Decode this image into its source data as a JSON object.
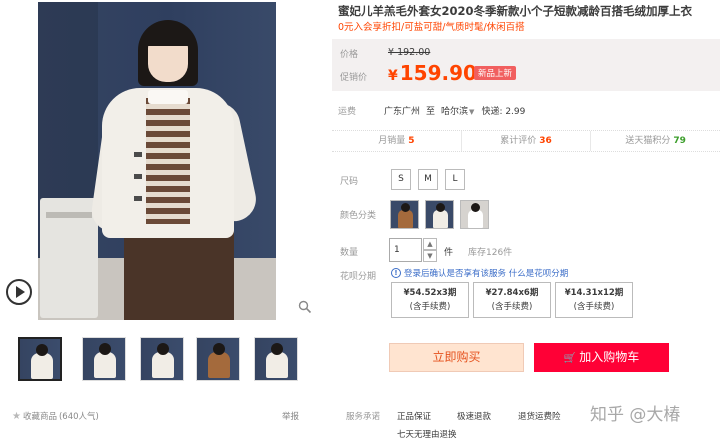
{
  "product": {
    "title": "蜜妃儿羊羔毛外套女2020冬季新款小个子短款减龄百搭毛绒加厚上衣",
    "subtitle": "0元入会享折扣/可盐可甜/气质时髦/休闲百搭"
  },
  "price": {
    "original_label": "价格",
    "original_value": "¥ 192.00",
    "promo_label": "促销价",
    "currency": "¥",
    "promo_value": "159.90",
    "badge": "新品上新"
  },
  "shipping": {
    "label": "运费",
    "from": "广东广州",
    "to_word": "至",
    "to": "哈尔滨",
    "express": "快递: 2.99"
  },
  "stats": [
    {
      "label": "月销量",
      "value": "5",
      "color": "#f40"
    },
    {
      "label": "累计评价",
      "value": "36",
      "color": "#f40"
    },
    {
      "label": "送天猫积分",
      "value": "79",
      "color": "#3c9e2b"
    }
  ],
  "size": {
    "label": "尺码",
    "options": [
      "S",
      "M",
      "L"
    ]
  },
  "color": {
    "label": "颜色分类"
  },
  "quantity": {
    "label": "数量",
    "value": "1",
    "unit": "件",
    "stock": "库存126件"
  },
  "huabei": {
    "label": "花呗分期",
    "note": "登录后确认是否享有该服务 什么是花呗分期",
    "plans": [
      {
        "amount": "¥54.52x3期",
        "fee": "(含手续费)"
      },
      {
        "amount": "¥27.84x6期",
        "fee": "(含手续费)"
      },
      {
        "amount": "¥14.31x12期",
        "fee": "(含手续费)"
      }
    ]
  },
  "actions": {
    "buy_now": "立即购买",
    "add_to_cart": "加入购物车"
  },
  "gallery": {
    "favorite": "收藏商品",
    "popularity": "(640人气)",
    "report": "举报"
  },
  "service": {
    "label": "服务承诺",
    "items": [
      "正品保证",
      "极速退款",
      "退货运费险",
      "七天无理由退换"
    ]
  },
  "watermark": "知乎 @大椿",
  "colors": {
    "accent": "#ff4400",
    "cart_button": "#ff0036",
    "buy_button_bg": "#ffe4d0"
  },
  "icons": [
    "play-icon",
    "zoom-icon",
    "star-icon",
    "info-icon",
    "cart-icon",
    "caret-down-icon"
  ]
}
